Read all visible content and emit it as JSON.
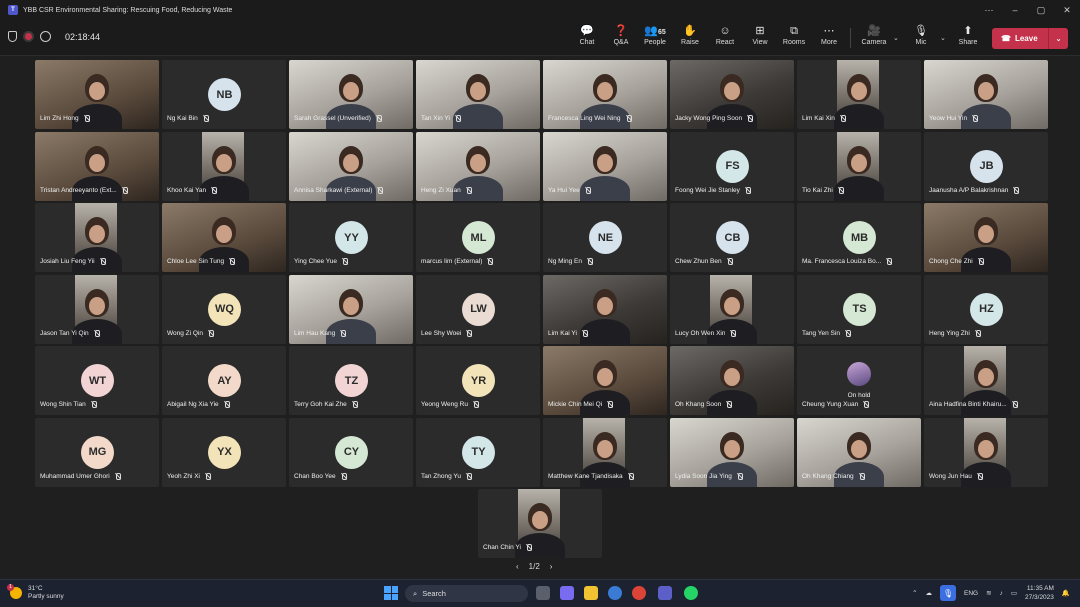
{
  "window": {
    "title": "YBB CSR Environmental Sharing: Rescuing Food, Reducing Waste",
    "controls": [
      "⋯",
      "–",
      "▢",
      "✕"
    ]
  },
  "toolbar": {
    "timer": "02:18:44",
    "buttons": [
      {
        "id": "chat",
        "label": "Chat",
        "glyph": "💬"
      },
      {
        "id": "qa",
        "label": "Q&A",
        "glyph": "❓"
      },
      {
        "id": "people",
        "label": "People",
        "glyph": "👥",
        "count": "65"
      },
      {
        "id": "raise",
        "label": "Raise",
        "glyph": "✋"
      },
      {
        "id": "react",
        "label": "React",
        "glyph": "☺"
      },
      {
        "id": "view",
        "label": "View",
        "glyph": "⊞"
      },
      {
        "id": "rooms",
        "label": "Rooms",
        "glyph": "⧉"
      },
      {
        "id": "more",
        "label": "More",
        "glyph": "⋯"
      },
      {
        "id": "camera",
        "label": "Camera",
        "glyph": "🎥"
      },
      {
        "id": "mic",
        "label": "Mic",
        "glyph": "🎙"
      },
      {
        "id": "share",
        "label": "Share",
        "glyph": "⬆"
      }
    ],
    "leave_label": "Leave"
  },
  "participants": [
    {
      "name": "Lim Zhi Hong",
      "type": "video",
      "style": "warm"
    },
    {
      "name": "Ng Kai Bin",
      "type": "avatar",
      "initials": "NB",
      "color": "#d7e3ec"
    },
    {
      "name": "Sarah Grassel (Unverified)",
      "type": "video",
      "style": "light"
    },
    {
      "name": "Tan Xin Yi",
      "type": "video",
      "style": "light"
    },
    {
      "name": "Francesca Ling Wei Ning",
      "type": "video",
      "style": "light"
    },
    {
      "name": "Jacky Wong Ping Soon",
      "type": "video",
      "style": "dark"
    },
    {
      "name": "Lim Kai Xin",
      "type": "narrow",
      "style": "dark"
    },
    {
      "name": "Yeow Hui Yin",
      "type": "video",
      "style": "light"
    },
    {
      "name": "Tristan Andreeyanto (Ext...",
      "type": "video",
      "style": "warm"
    },
    {
      "name": "Khoo Kai Yan",
      "type": "narrow",
      "style": "warm"
    },
    {
      "name": "Annisa Sharkawi (External)",
      "type": "video",
      "style": "light"
    },
    {
      "name": "Heng Zi Xuan",
      "type": "video",
      "style": "light"
    },
    {
      "name": "Ya Hui Yee",
      "type": "video",
      "style": "light"
    },
    {
      "name": "Foong Wei Jie Stanley",
      "type": "avatar",
      "initials": "FS",
      "color": "#d3e6e8"
    },
    {
      "name": "Tio Kai Zhi",
      "type": "narrow",
      "style": "light"
    },
    {
      "name": "Jaanusha A/P Balakrishnan",
      "type": "avatar",
      "initials": "JB",
      "color": "#d7e3ec"
    },
    {
      "name": "Josiah Liu Feng Yii",
      "type": "narrow",
      "style": "dark"
    },
    {
      "name": "Chloe Lee Sin Tung",
      "type": "video",
      "style": "warm"
    },
    {
      "name": "Ying Chee Yue",
      "type": "avatar",
      "initials": "YY",
      "color": "#d3e6e8"
    },
    {
      "name": "marcus lim (External)",
      "type": "avatar",
      "initials": "ML",
      "color": "#d5e8d4"
    },
    {
      "name": "Ng Ming En",
      "type": "avatar",
      "initials": "NE",
      "color": "#d7e3ec"
    },
    {
      "name": "Chew Zhun Ben",
      "type": "avatar",
      "initials": "CB",
      "color": "#d7e3ec"
    },
    {
      "name": "Ma. Francesca Louiza Bo...",
      "type": "avatar",
      "initials": "MB",
      "color": "#d5e8d4"
    },
    {
      "name": "Chong Che Zhi",
      "type": "video",
      "style": "warm"
    },
    {
      "name": "Jason Tan Yi Qin",
      "type": "narrow",
      "style": "light"
    },
    {
      "name": "Wong Zi Qin",
      "type": "avatar",
      "initials": "WQ",
      "color": "#f3e3b8"
    },
    {
      "name": "Lim Hau Kang",
      "type": "video",
      "style": "light"
    },
    {
      "name": "Lee Shy Woei",
      "type": "avatar",
      "initials": "LW",
      "color": "#eadbd3"
    },
    {
      "name": "Lim Kai Yi",
      "type": "video",
      "style": "dark"
    },
    {
      "name": "Lucy Oh Wen Xin",
      "type": "narrow",
      "style": "light"
    },
    {
      "name": "Tang Yen Sin",
      "type": "avatar",
      "initials": "TS",
      "color": "#d5e8d4"
    },
    {
      "name": "Heng Ying Zhi",
      "type": "avatar",
      "initials": "HZ",
      "color": "#d3e6e8"
    },
    {
      "name": "Wong Shin Tian",
      "type": "avatar",
      "initials": "WT",
      "color": "#f2d4d4"
    },
    {
      "name": "Abigail Ng Xia Yie",
      "type": "avatar",
      "initials": "AY",
      "color": "#f2d9c9"
    },
    {
      "name": "Terry Goh Kai Zhe",
      "type": "avatar",
      "initials": "TZ",
      "color": "#f2d4d4"
    },
    {
      "name": "Yeong Weng Ru",
      "type": "avatar",
      "initials": "YR",
      "color": "#f3e3b8"
    },
    {
      "name": "Mickie Chin Mei Qi",
      "type": "video",
      "style": "warm"
    },
    {
      "name": "Oh Khang Soon",
      "type": "video",
      "style": "dark"
    },
    {
      "name": "Cheung Yung Xuan",
      "type": "onhold",
      "hold_label": "On hold"
    },
    {
      "name": "Aina Hadfina Binti Khairu...",
      "type": "narrow",
      "style": "warm"
    },
    {
      "name": "Muhammad Umer Ghori",
      "type": "avatar",
      "initials": "MG",
      "color": "#f2d9c9"
    },
    {
      "name": "Yeoh Zhi Xi",
      "type": "avatar",
      "initials": "YX",
      "color": "#f3e3b8"
    },
    {
      "name": "Chan Boo Yee",
      "type": "avatar",
      "initials": "CY",
      "color": "#d5e8d4"
    },
    {
      "name": "Tan Zhong Yu",
      "type": "avatar",
      "initials": "TY",
      "color": "#d3e6e8"
    },
    {
      "name": "Matthew Kane Tjandisaka",
      "type": "narrow",
      "style": "warm"
    },
    {
      "name": "Lydia Soon Jia Ying",
      "type": "video",
      "style": "light"
    },
    {
      "name": "Oh Khang Chiang",
      "type": "video",
      "style": "light"
    },
    {
      "name": "Wong Jun Hau",
      "type": "narrow",
      "style": "light"
    },
    {
      "name": "Chan Chin Yi",
      "type": "narrow",
      "style": "light"
    }
  ],
  "pager": {
    "prev": "‹",
    "label": "1/2",
    "next": "›"
  },
  "taskbar": {
    "weather_temp": "31°C",
    "weather_desc": "Partly sunny",
    "weather_badge": "1",
    "search_label": "Search",
    "language": "ENG",
    "time": "11:35 AM",
    "date": "27/3/2023"
  }
}
